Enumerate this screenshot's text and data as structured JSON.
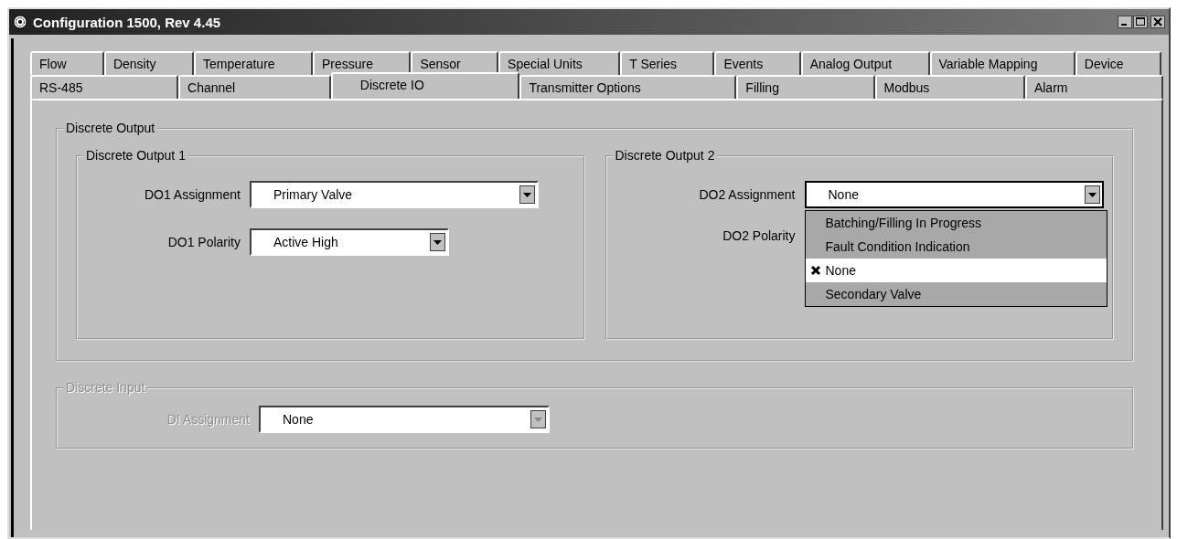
{
  "window": {
    "title": "Configuration 1500, Rev 4.45"
  },
  "tab_rows": [
    {
      "tabs": [
        {
          "label": "Flow",
          "selected": false
        },
        {
          "label": "Density",
          "selected": false
        },
        {
          "label": "Temperature",
          "selected": false
        },
        {
          "label": "Pressure",
          "selected": false
        },
        {
          "label": "Sensor",
          "selected": false
        },
        {
          "label": "Special Units",
          "selected": false
        },
        {
          "label": "T Series",
          "selected": false
        },
        {
          "label": "Events",
          "selected": false
        },
        {
          "label": "Analog Output",
          "selected": false
        },
        {
          "label": "Variable Mapping",
          "selected": false
        },
        {
          "label": "Device",
          "selected": false
        }
      ]
    },
    {
      "tabs": [
        {
          "label": "RS-485",
          "selected": false
        },
        {
          "label": "Channel",
          "selected": false
        },
        {
          "label": "Discrete IO",
          "selected": true
        },
        {
          "label": "Transmitter Options",
          "selected": false
        },
        {
          "label": "Filling",
          "selected": false
        },
        {
          "label": "Modbus",
          "selected": false
        },
        {
          "label": "Alarm",
          "selected": false
        }
      ]
    }
  ],
  "discrete_output": {
    "title": "Discrete Output",
    "groups": [
      {
        "title": "Discrete Output 1",
        "fields": [
          {
            "label": "DO1 Assignment",
            "value": "Primary Valve",
            "expanded": false
          },
          {
            "label": "DO1 Polarity",
            "value": "Active High",
            "expanded": false
          }
        ]
      },
      {
        "title": "Discrete Output 2",
        "fields": [
          {
            "label": "DO2 Assignment",
            "value": "None",
            "expanded": true,
            "options": [
              {
                "label": "Batching/Filling In Progress",
                "selected": false
              },
              {
                "label": "Fault Condition Indication",
                "selected": false
              },
              {
                "label": "None",
                "selected": true
              },
              {
                "label": "Secondary Valve",
                "selected": false
              }
            ]
          },
          {
            "label": "DO2 Polarity"
          }
        ]
      }
    ]
  },
  "discrete_input": {
    "title": "Discrete Input",
    "disabled": true,
    "fields": [
      {
        "label": "DI Assignment",
        "value": "None",
        "expanded": false
      }
    ]
  }
}
